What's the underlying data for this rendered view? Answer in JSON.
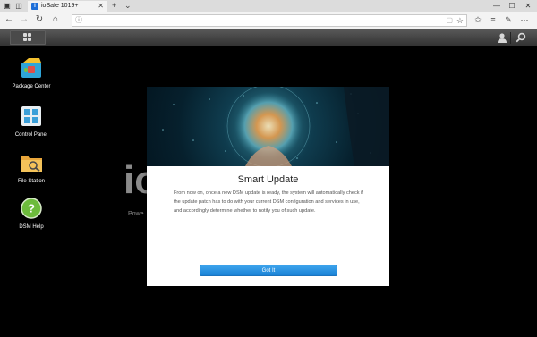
{
  "browser": {
    "tab_title": "ioSafe 1019+",
    "tab_icon": "ioSafe",
    "new_tab": "+",
    "tab_menu": "⌄",
    "window_buttons": [
      "—",
      "☐",
      "✕"
    ],
    "address_value": "",
    "address_placeholder": ""
  },
  "desktop": {
    "icons": [
      {
        "label": "Package Center",
        "icon": "package-center-icon"
      },
      {
        "label": "Control Panel",
        "icon": "control-panel-icon"
      },
      {
        "label": "File Station",
        "icon": "file-station-icon"
      },
      {
        "label": "DSM Help",
        "icon": "dsm-help-icon",
        "glyph": "?"
      }
    ],
    "background_brand": "io",
    "background_subtitle": "Powe"
  },
  "dialog": {
    "title": "Smart Update",
    "body": "From now on, once a new DSM update is ready, the system will automatically check if the update patch has to do with your current DSM configuration and services in use, and accordingly determine whether to notify you of such update.",
    "button_label": "Got It"
  },
  "colors": {
    "accent": "#1a82d6",
    "taskbar": "#3c3c3c",
    "desktop": "#000000"
  }
}
